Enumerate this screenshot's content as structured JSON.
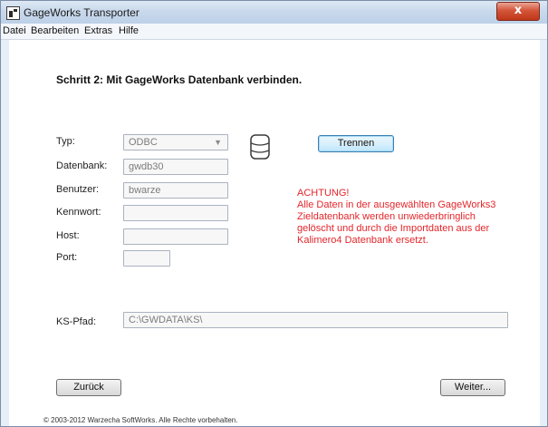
{
  "window": {
    "title": "GageWorks Transporter",
    "close_glyph": "x"
  },
  "menu": {
    "items": [
      "Datei",
      "Bearbeiten",
      "Extras",
      "Hilfe"
    ]
  },
  "page": {
    "title": "Schritt 2: Mit GageWorks Datenbank verbinden."
  },
  "form": {
    "typ": {
      "label": "Typ:",
      "value": "ODBC",
      "arrow_icon": "chevron-down-icon"
    },
    "datenbank": {
      "label": "Datenbank:",
      "value": "gwdb30"
    },
    "benutzer": {
      "label": "Benutzer:",
      "value": "bwarze"
    },
    "kennwort": {
      "label": "Kennwort:",
      "value": ""
    },
    "host": {
      "label": "Host:",
      "value": ""
    },
    "port": {
      "label": "Port:",
      "value": ""
    },
    "ks_pfad": {
      "label": "KS-Pfad:",
      "value": "C:\\GWDATA\\KS\\"
    }
  },
  "icons": {
    "database": "database-icon"
  },
  "buttons": {
    "trennen": "Trennen",
    "zurueck": "Zurück",
    "weiter": "Weiter..."
  },
  "warning": {
    "heading": "ACHTUNG!",
    "lines": [
      "Alle Daten in der ausgewählten GageWorks3",
      "Zieldatenbank werden unwiederbringlich",
      "gelöscht und durch die Importdaten aus der",
      "Kalimero4 Datenbank ersetzt."
    ],
    "color": "#e3262b"
  },
  "footer": {
    "copyright": "© 2003-2012 Warzecha SoftWorks. Alle Rechte vorbehalten."
  }
}
